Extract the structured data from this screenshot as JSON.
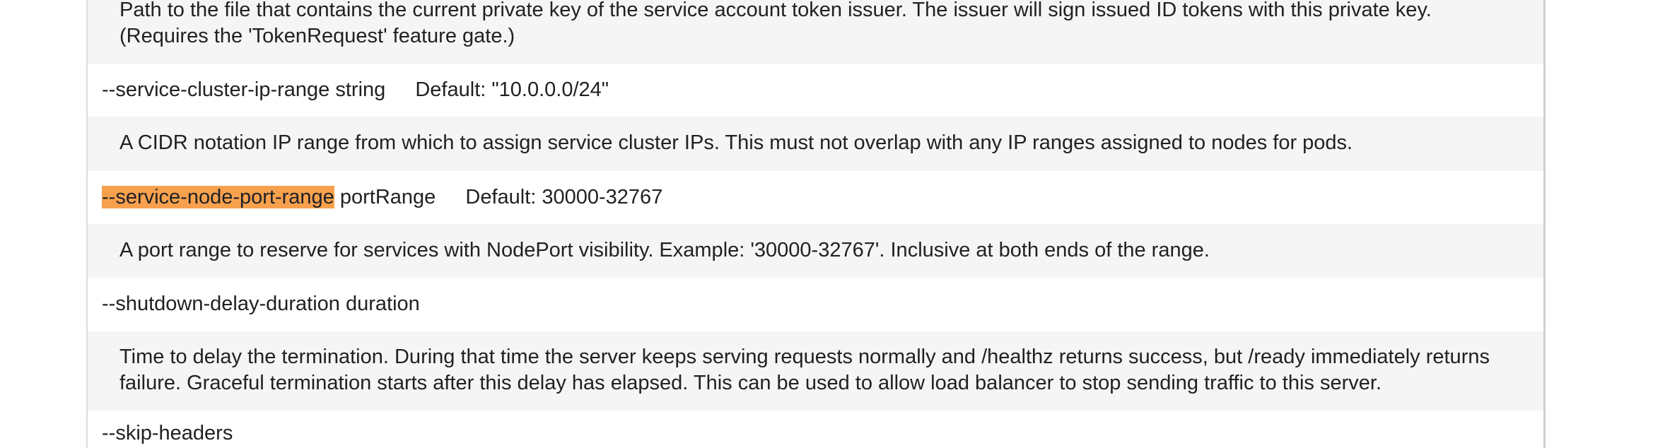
{
  "rows": [
    {
      "kind": "desc",
      "lines": [
        "Path to the file that contains the current private key of the service account token issuer. The issuer will sign issued ID tokens with this private key.",
        "(Requires the 'TokenRequest' feature gate.)"
      ]
    },
    {
      "kind": "flag",
      "flag": "--service-cluster-ip-range",
      "type": "string",
      "default": "Default: \"10.0.0.0/24\""
    },
    {
      "kind": "desc",
      "lines": [
        "A CIDR notation IP range from which to assign service cluster IPs. This must not overlap with any IP ranges assigned to nodes for pods."
      ]
    },
    {
      "kind": "flag",
      "flag": "--service-node-port-range",
      "highlighted": true,
      "highlight_color": "#f7a14e",
      "type": "portRange",
      "default": "Default: 30000-32767"
    },
    {
      "kind": "desc",
      "lines": [
        "A port range to reserve for services with NodePort visibility. Example: '30000-32767'. Inclusive at both ends of the range."
      ]
    },
    {
      "kind": "flag",
      "flag": "--shutdown-delay-duration",
      "type": "duration",
      "default": ""
    },
    {
      "kind": "desc",
      "lines": [
        "Time to delay the termination. During that time the server keeps serving requests normally and /healthz returns success, but /ready immediately returns",
        "failure. Graceful termination starts after this delay has elapsed. This can be used to allow load balancer to stop sending traffic to this server."
      ]
    },
    {
      "kind": "flag",
      "flag": "--skip-headers",
      "type": "",
      "default": ""
    }
  ]
}
